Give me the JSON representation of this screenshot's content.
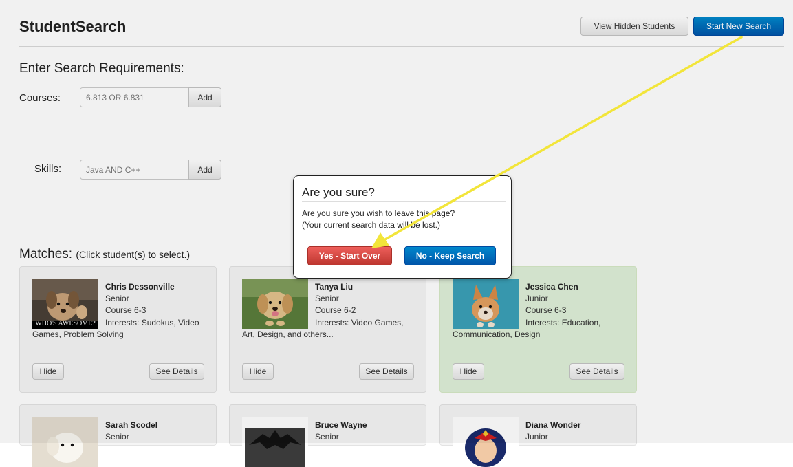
{
  "header": {
    "title": "StudentSearch",
    "view_hidden_label": "View Hidden Students",
    "start_new_label": "Start New Search"
  },
  "search": {
    "heading": "Enter Search Requirements:",
    "courses": {
      "label": "Courses:",
      "placeholder": "6.813 OR 6.831",
      "add_label": "Add"
    },
    "skills": {
      "label": "Skills:",
      "placeholder": "Java AND C++",
      "add_label": "Add"
    }
  },
  "matches": {
    "heading": "Matches:",
    "hint": "(Click student(s) to select.)",
    "hide_label": "Hide",
    "details_label": "See Details",
    "students": [
      {
        "name": "Chris Dessonville",
        "year": "Senior",
        "course": "Course 6-3",
        "interests": "Interests: Sudokus, Video Games, Problem Solving",
        "photo_caption": "WHO'S AWESOME?",
        "selected": false
      },
      {
        "name": "Tanya Liu",
        "year": "Senior",
        "course": "Course 6-2",
        "interests": "Interests: Video Games, Art, Design, and others...",
        "selected": false
      },
      {
        "name": "Jessica Chen",
        "year": "Junior",
        "course": "Course 6-3",
        "interests": "Interests: Education, Communication, Design",
        "selected": true
      },
      {
        "name": "Sarah Scodel",
        "year": "Senior"
      },
      {
        "name": "Bruce Wayne",
        "year": "Senior"
      },
      {
        "name": "Diana Wonder",
        "year": "Junior"
      }
    ]
  },
  "dialog": {
    "title": "Are you sure?",
    "message_line1": "Are you sure you wish to leave this page?",
    "message_line2": "(Your current search data will be lost.)",
    "yes_label": "Yes - Start Over",
    "no_label": "No - Keep Search"
  },
  "colors": {
    "primary": "#0062c4",
    "danger": "#c9302c",
    "selected_card": "#dff0d8",
    "annotation_arrow": "#f2e53a"
  }
}
